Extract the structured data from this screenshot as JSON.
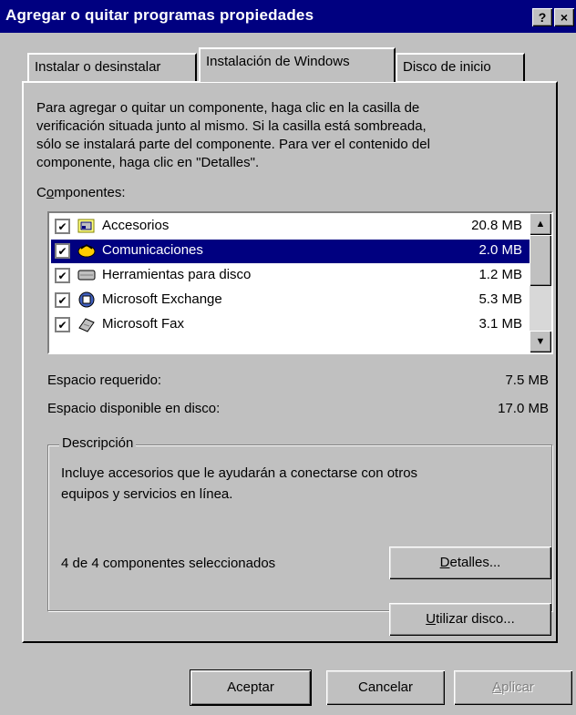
{
  "window": {
    "title": "Agregar o quitar programas propiedades",
    "help_btn": "?",
    "close_btn": "×"
  },
  "tabs": [
    {
      "label": "Instalar o desinstalar"
    },
    {
      "label": "Instalación de Windows"
    },
    {
      "label": "Disco de inicio"
    }
  ],
  "intro": [
    "Para agregar o quitar un componente, haga clic en la casilla de",
    "verificación situada junto al mismo. Si la casilla está sombreada,",
    "sólo se instalará parte del componente. Para ver el contenido del",
    "componente, haga clic en \"Detalles\"."
  ],
  "components_label": {
    "pre": "C",
    "ul": "o",
    "post": "mponentes:"
  },
  "components": [
    {
      "name": "Accesorios",
      "size": "20.8 MB",
      "checked": true,
      "icon": "accessories-icon"
    },
    {
      "name": "Comunicaciones",
      "size": "2.0 MB",
      "checked": true,
      "icon": "communications-icon"
    },
    {
      "name": "Herramientas para disco",
      "size": "1.2 MB",
      "checked": true,
      "icon": "disk-tools-icon"
    },
    {
      "name": "Microsoft Exchange",
      "size": "5.3 MB",
      "checked": true,
      "icon": "exchange-icon"
    },
    {
      "name": "Microsoft Fax",
      "size": "3.1 MB",
      "checked": true,
      "icon": "fax-icon"
    }
  ],
  "space": {
    "required_label": "Espacio requerido:",
    "required_value": "7.5 MB",
    "available_label": "Espacio disponible en disco:",
    "available_value": "17.0 MB"
  },
  "description": {
    "legend": "Descripción",
    "line1": "Incluye accesorios que le ayudarán a conectarse con otros",
    "line2": "equipos y servicios en línea.",
    "selected_count": "4 de 4 componentes seleccionados"
  },
  "buttons": {
    "details": {
      "ul": "D",
      "rest": "etalles..."
    },
    "use_disk": {
      "ul": "U",
      "rest": "tilizar disco..."
    },
    "ok": "Aceptar",
    "cancel": "Cancelar",
    "apply": {
      "ul": "A",
      "rest": "plicar"
    }
  }
}
